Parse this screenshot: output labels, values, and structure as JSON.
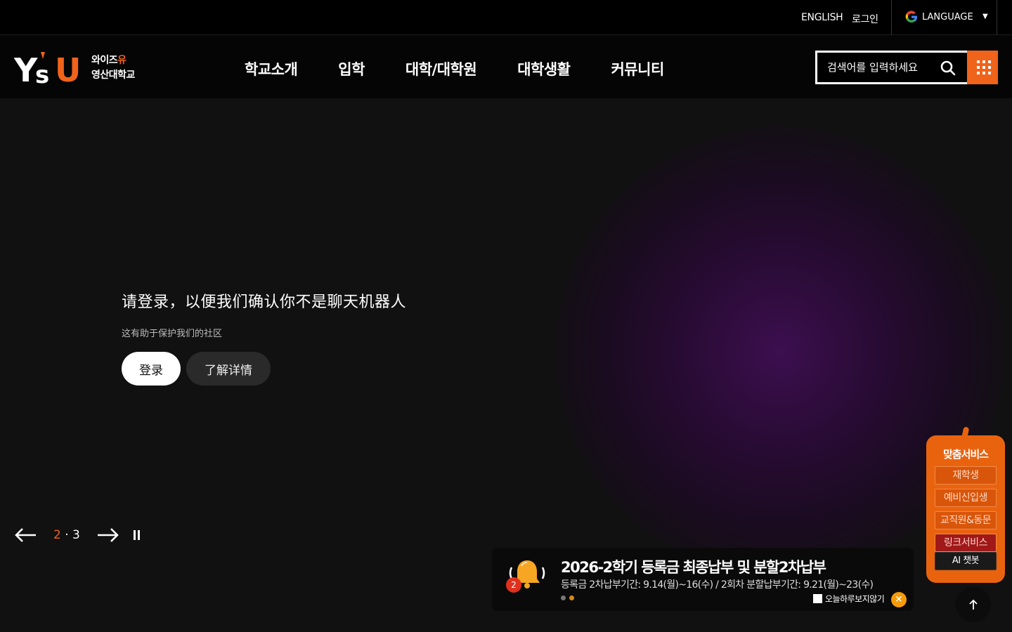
{
  "topbar": {
    "english": "ENGLISH",
    "login": "로그인",
    "language": "LANGUAGE"
  },
  "header": {
    "logo_line1_a": "와이즈",
    "logo_line1_b": "유",
    "logo_line2": "영산대학교",
    "nav": [
      "학교소개",
      "입학",
      "대학/대학원",
      "대학생활",
      "커뮤니티"
    ],
    "search_placeholder": "검색어를 입력하세요"
  },
  "hero": {
    "captcha_title": "请登录，以便我们确认你不是聊天机器人",
    "captcha_desc": "这有助于保护我们的社区",
    "login_button": "登录",
    "learn_more_button": "了解详情"
  },
  "slider": {
    "current": "2",
    "separator": "·",
    "total": "3"
  },
  "notice": {
    "badge_count": "2",
    "title": "2026-2학기 등록금 최종납부 및 분할2차납부",
    "desc": "등록금 2차납부기간: 9.14(월)~16(수) / 2회차 분할납부기간: 9.21(월)~23(수)",
    "today_hide": "오늘하루보지않기",
    "close": "×"
  },
  "quick_service": {
    "title": "맞춤서비스",
    "items": [
      "재학생",
      "예비신입생",
      "교직원&동문",
      "링크서비스"
    ],
    "ai": "AI 챗봇"
  },
  "colors": {
    "accent": "#f0631b",
    "quick_bg": "#e9630f",
    "notice_dot_active": "#d08a1c",
    "close_bg": "#f59c0a"
  }
}
